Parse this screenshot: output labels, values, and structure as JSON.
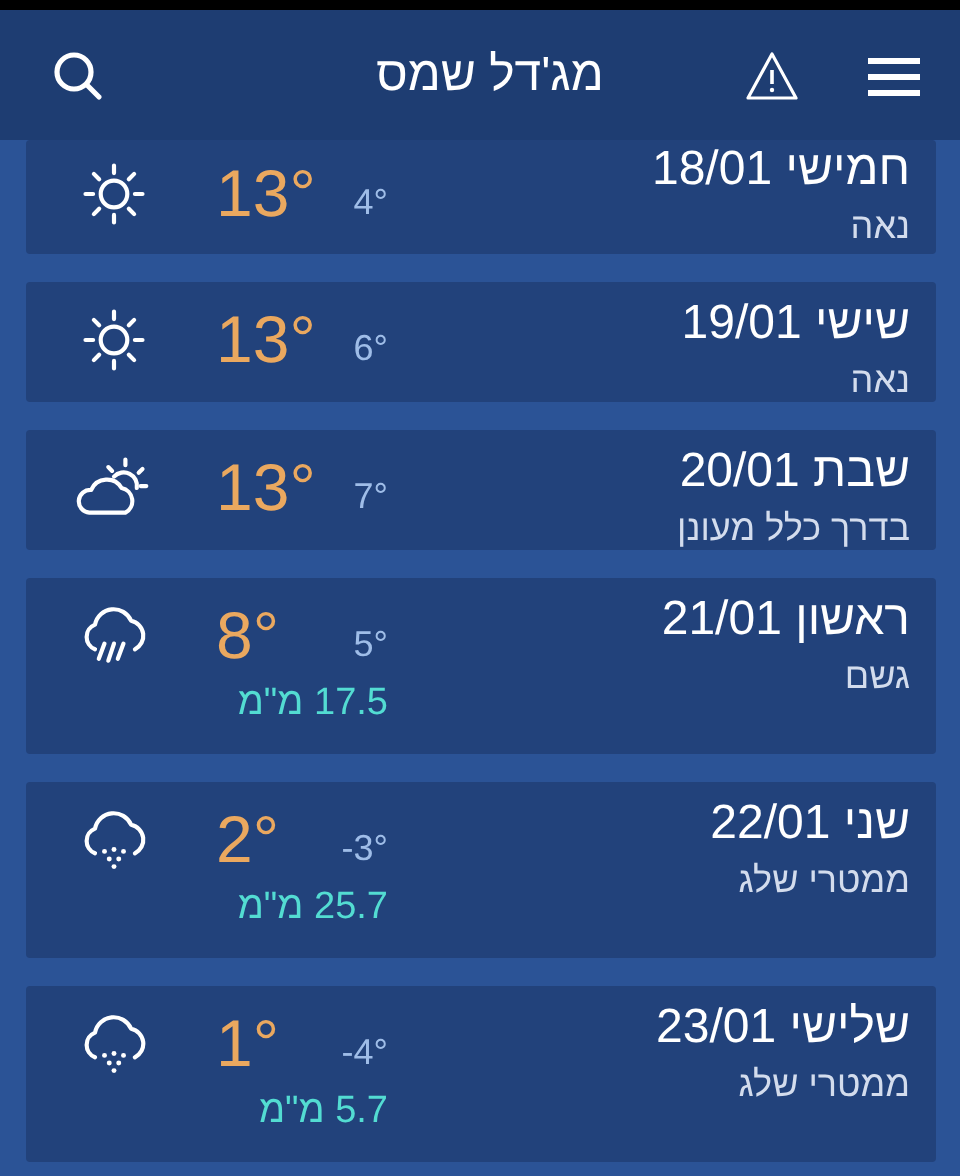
{
  "header": {
    "title": "מג'דל שמס"
  },
  "days": [
    {
      "day": "חמישי 18/01",
      "condition": "נאה",
      "kind": "sun",
      "high": "13°",
      "low": "4°"
    },
    {
      "day": "שישי 19/01",
      "condition": "נאה",
      "kind": "sun",
      "high": "13°",
      "low": "6°"
    },
    {
      "day": "שבת 20/01",
      "condition": "בדרך כלל מעונן",
      "kind": "partly-cloudy",
      "high": "13°",
      "low": "7°"
    },
    {
      "day": "ראשון 21/01",
      "condition": "גשם",
      "kind": "rain",
      "high": "8°",
      "low": "5°",
      "precip": "17.5 מ\"מ"
    },
    {
      "day": "שני 22/01",
      "condition": "ממטרי שלג",
      "kind": "snow",
      "high": "2°",
      "low": "-3°",
      "precip": "25.7 מ\"מ"
    },
    {
      "day": "שלישי 23/01",
      "condition": "ממטרי שלג",
      "kind": "snow",
      "high": "1°",
      "low": "-4°",
      "precip": "5.7 מ\"מ"
    }
  ]
}
